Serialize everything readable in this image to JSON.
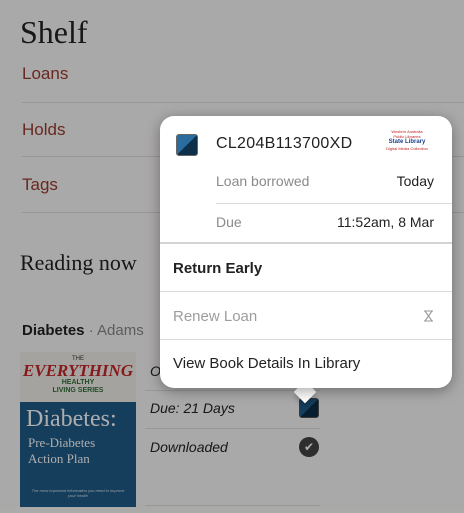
{
  "page": {
    "title": "Shelf",
    "nav": [
      "Loans",
      "Holds",
      "Tags"
    ],
    "section_title": "Reading now"
  },
  "book": {
    "title": "Diabetes",
    "separator": "·",
    "author_partial": "Adams",
    "cover": {
      "the": "THE",
      "brand": "EVERYTHING",
      "series1": "HEALTHY",
      "series2": "LIVING SERIES",
      "title": "Diabetes:",
      "subtitle1": "Pre-Diabetes",
      "subtitle2": "Action Plan",
      "tagline": "The most important information you need to improve your health"
    },
    "status_partial": "O",
    "due": "Due: 21 Days",
    "downloaded": "Downloaded"
  },
  "popover": {
    "loan_id": "CL204B113700XD",
    "library_logo": {
      "line1": "Western Australia Public Libraries",
      "line2": "State Library",
      "line3": "Digital Media Collection"
    },
    "rows": [
      {
        "label": "Loan borrowed",
        "value": "Today"
      },
      {
        "label": "Due",
        "value": "11:52am, 8 Mar"
      }
    ],
    "actions": {
      "return_early": "Return Early",
      "renew_loan": "Renew Loan",
      "view_details": "View Book Details In Library"
    }
  },
  "colors": {
    "accent": "#9b3a2e",
    "dim_overlay": "rgba(0,0,0,0.32)"
  }
}
